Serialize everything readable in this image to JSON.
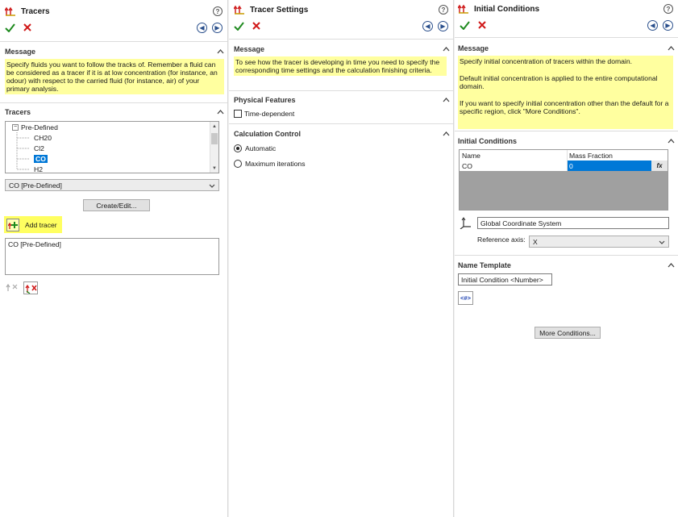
{
  "tracers_panel": {
    "title": "Tracers",
    "message_header": "Message",
    "message": "Specify fluids you want to follow the tracks of. Remember a fluid can be considered as a tracer if it is at low concentration (for instance, an odour) with respect to the carried fluid (for instance, air) of your primary analysis.",
    "tracers_header": "Tracers",
    "tree": {
      "root": "Pre-Defined",
      "items": [
        "CH20",
        "Cl2",
        "CO",
        "H2"
      ],
      "selected": "CO"
    },
    "combo_value": "CO [Pre-Defined]",
    "create_edit_label": "Create/Edit...",
    "add_tracer_label": "Add tracer",
    "added_list": [
      "CO [Pre-Defined]"
    ]
  },
  "settings_panel": {
    "title": "Tracer Settings",
    "message_header": "Message",
    "message": "To see how the tracer is developing in time you need to specify the corresponding time settings and the calculation finishing criteria.",
    "physical_header": "Physical Features",
    "time_dependent_label": "Time-dependent",
    "calc_header": "Calculation Control",
    "automatic_label": "Automatic",
    "max_iter_label": "Maximum iterations"
  },
  "ic_panel": {
    "title": "Initial Conditions",
    "message_header": "Message",
    "message_lines": [
      "Specify initial concentration of tracers within the domain.",
      "Default initial concentration is applied to the entire computational domain.",
      "If you want to specify initial concentration other than the default for a specific region, click \"More Conditions\"."
    ],
    "ic_header": "Initial Conditions",
    "grid": {
      "col_name": "Name",
      "col_mass": "Mass Fraction",
      "row_name": "CO",
      "row_value": "0",
      "fx_label": "fx"
    },
    "coord_system": "Global Coordinate System",
    "ref_axis_label": "Reference axis:",
    "ref_axis_value": "X",
    "name_template_header": "Name Template",
    "name_template_value": "Initial Condition <Number>",
    "number_token_label": "<#>",
    "more_conditions_label": "More Conditions..."
  },
  "colors": {
    "message_bg": "#ffff9f",
    "ok_green": "#1e8a1e",
    "cancel_red": "#d01818",
    "selection_blue": "#0078d7"
  }
}
